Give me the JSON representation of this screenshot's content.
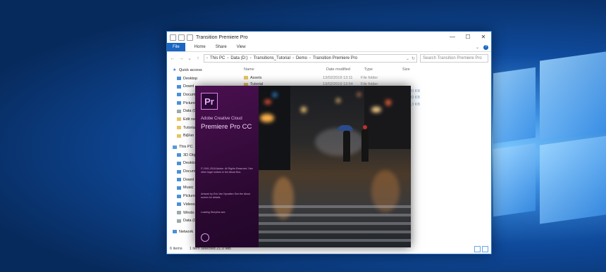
{
  "explorer": {
    "title": "Transition Premiere Pro",
    "window_controls": {
      "minimize": "—",
      "maximize": "☐",
      "close": "✕"
    },
    "ribbon": {
      "file": "File",
      "tabs": [
        "Home",
        "Share",
        "View"
      ]
    },
    "address": {
      "crumbs": [
        "This PC",
        "Data (D:)",
        "Transitions_Tutorial",
        "Demo",
        "Transition Premiere Pro"
      ],
      "search_placeholder": "Search Transition Premiere Pro"
    },
    "sidebar": {
      "items": [
        {
          "label": "Quick access",
          "icon": "star-icon"
        },
        {
          "label": "Desktop",
          "icon": "desktop-icon"
        },
        {
          "label": "Downl",
          "icon": "download-icon"
        },
        {
          "label": "Docum",
          "icon": "document-icon"
        },
        {
          "label": "Pictures",
          "icon": "pictures-icon"
        },
        {
          "label": "Data (D:",
          "icon": "drive-icon"
        },
        {
          "label": "Edit ne",
          "icon": "folder-icon"
        },
        {
          "label": "Tutoria",
          "icon": "folder-icon"
        },
        {
          "label": "Βιβλιο",
          "icon": "folder-icon"
        },
        {
          "label": "This PC",
          "icon": "pc-icon"
        },
        {
          "label": "3D Obje",
          "icon": "3d-icon"
        },
        {
          "label": "Deskto",
          "icon": "desktop-icon"
        },
        {
          "label": "Docum",
          "icon": "document-icon"
        },
        {
          "label": "Downl",
          "icon": "download-icon"
        },
        {
          "label": "Music",
          "icon": "music-icon"
        },
        {
          "label": "Picture",
          "icon": "pictures-icon"
        },
        {
          "label": "Videos",
          "icon": "videos-icon"
        },
        {
          "label": "Windo",
          "icon": "drive-icon"
        },
        {
          "label": "Data (D",
          "icon": "drive-icon"
        },
        {
          "label": "Network",
          "icon": "network-icon"
        }
      ]
    },
    "columns": {
      "name": "Name",
      "date": "Date modified",
      "type": "Type",
      "size": "Size"
    },
    "files": [
      {
        "name": "Assets",
        "date": "13/02/2019 13:11",
        "type": "File folder",
        "size": ""
      },
      {
        "name": "Tutorial",
        "date": "13/02/2019 13:54",
        "type": "File folder",
        "size": ""
      },
      {
        "name": "",
        "date": "",
        "type": "",
        "size": "520 KB"
      },
      {
        "name": "",
        "date": "",
        "type": "",
        "size": ".093 KB"
      },
      {
        "name": "",
        "date": "",
        "type": "",
        "size": ".613 KB"
      }
    ],
    "status": {
      "items": "6 items",
      "selected": "1 item selected  21.0 MB"
    }
  },
  "splash": {
    "logo": "Pr",
    "brand": "Adobe Creative Cloud",
    "product": "Premiere Pro CC",
    "legal": "© 1991-2018 Adobe. All Rights Reserved. See other legal notices in the About Box.",
    "artwork": "Artwork by Eric Van Nynatten See the About screen for details",
    "loading": "Loading Storyline.aex"
  },
  "colors": {
    "accent": "#1a66c2",
    "premiere_purple": "#2a0830",
    "premiere_logo": "#e27ef0"
  }
}
